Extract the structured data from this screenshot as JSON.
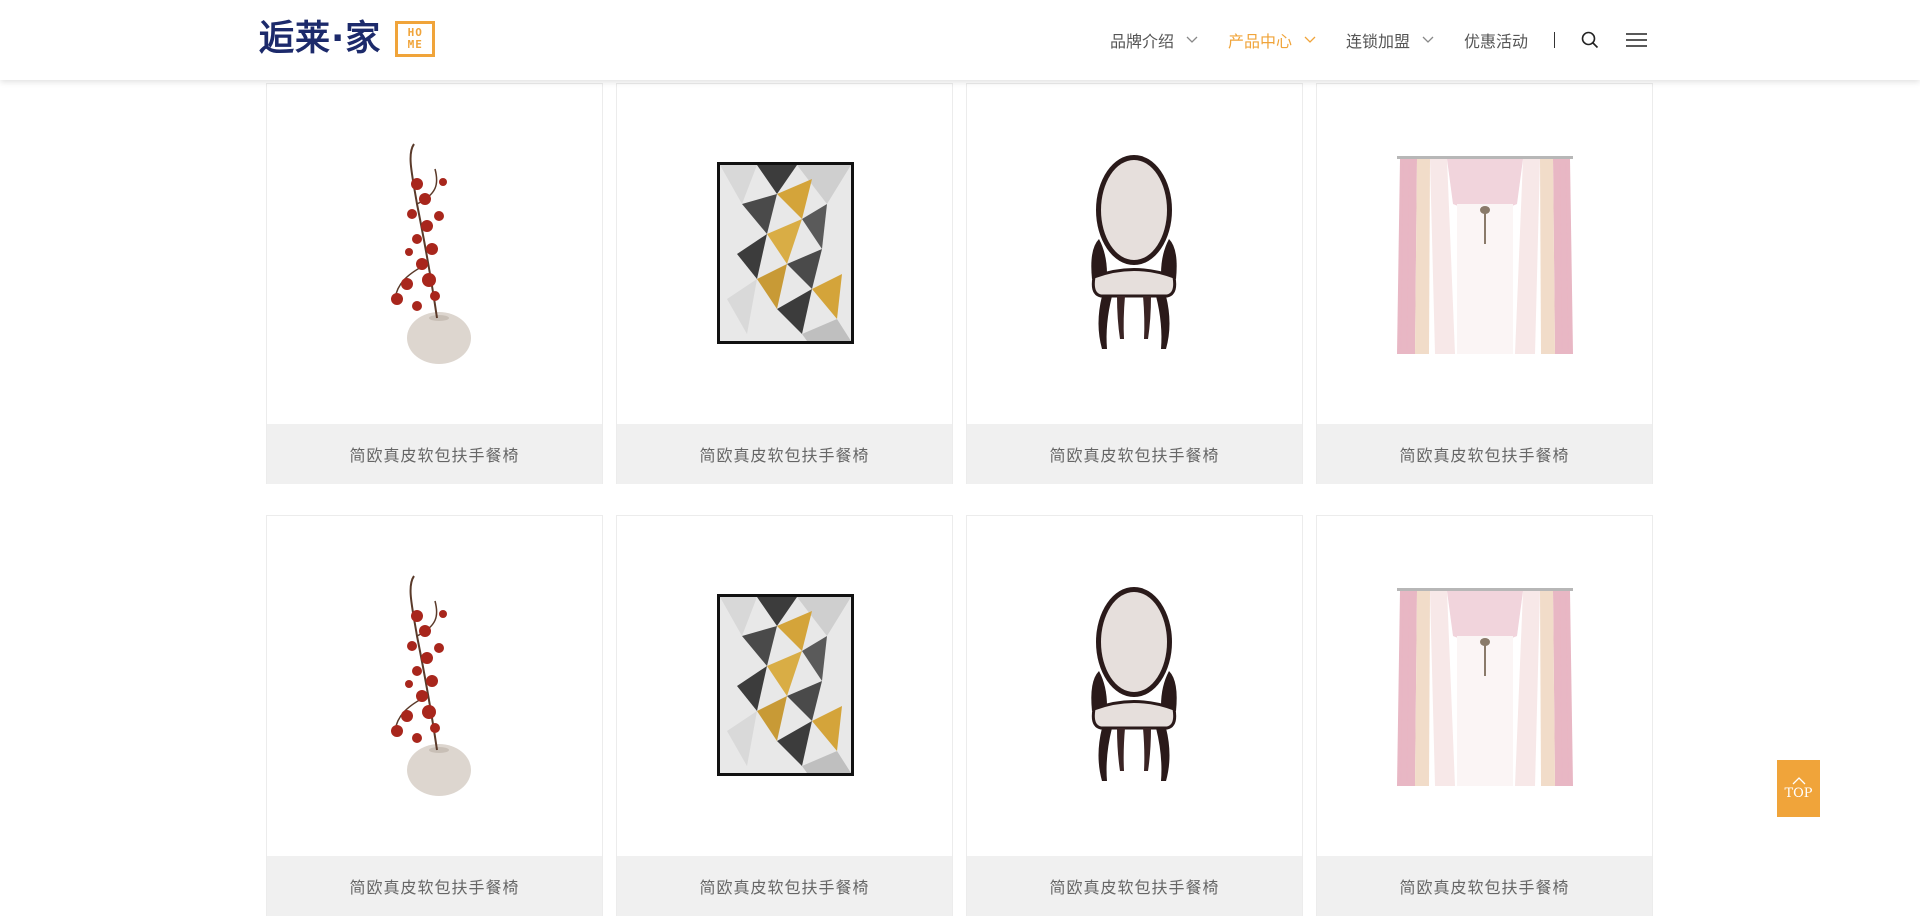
{
  "brand": {
    "name": "逅莱·家",
    "badge_top": "HO",
    "badge_bottom": "ME",
    "accent_color": "#f0a43a",
    "brand_color": "#1c2a6b"
  },
  "nav": {
    "items": [
      {
        "label": "品牌介绍",
        "has_dropdown": true,
        "active": false
      },
      {
        "label": "产品中心",
        "has_dropdown": true,
        "active": true
      },
      {
        "label": "连锁加盟",
        "has_dropdown": true,
        "active": false
      },
      {
        "label": "优惠活动",
        "has_dropdown": false,
        "active": false
      }
    ],
    "separator": "|",
    "search_icon": "search-icon",
    "menu_icon": "hamburger-menu-icon"
  },
  "products": [
    {
      "title": "简欧真皮软包扶手餐椅",
      "image": "plum-blossom-vase"
    },
    {
      "title": "简欧真皮软包扶手餐椅",
      "image": "geometric-wall-art"
    },
    {
      "title": "简欧真皮软包扶手餐椅",
      "image": "oval-back-chair"
    },
    {
      "title": "简欧真皮软包扶手餐椅",
      "image": "pink-curtains"
    },
    {
      "title": "简欧真皮软包扶手餐椅",
      "image": "plum-blossom-vase"
    },
    {
      "title": "简欧真皮软包扶手餐椅",
      "image": "geometric-wall-art"
    },
    {
      "title": "简欧真皮软包扶手餐椅",
      "image": "oval-back-chair"
    },
    {
      "title": "简欧真皮软包扶手餐椅",
      "image": "pink-curtains"
    }
  ],
  "back_to_top": {
    "label": "TOP",
    "icon": "chevron-up-icon"
  }
}
